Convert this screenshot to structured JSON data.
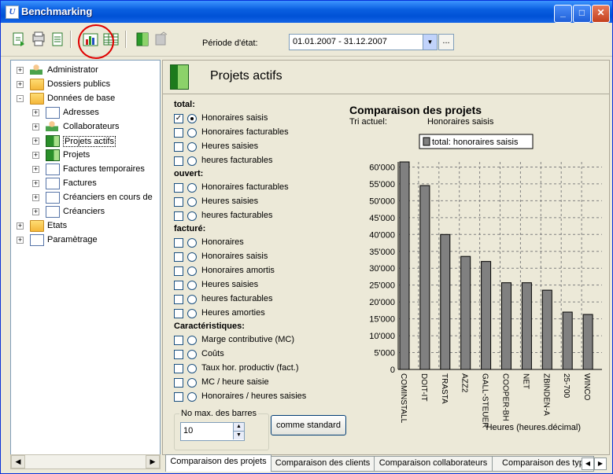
{
  "window": {
    "title": "Benchmarking",
    "app_icon_letter": "U"
  },
  "toolbar": {
    "period_label": "Période d'état:",
    "period_value": "01.01.2007 - 31.12.2007",
    "ellipsis_label": "..."
  },
  "tree": {
    "items": [
      {
        "label": "Administrator",
        "icon": "person-icon",
        "expander": "+"
      },
      {
        "label": "Dossiers publics",
        "icon": "folder-icon",
        "expander": "+"
      },
      {
        "label": "Données de base",
        "icon": "folder-icon",
        "expander": "−"
      },
      {
        "label": "Adresses",
        "icon": "address-book-icon",
        "expander": "+"
      },
      {
        "label": "Collaborateurs",
        "icon": "person-icon",
        "expander": "+"
      },
      {
        "label": "Projets actifs",
        "icon": "binder-icon",
        "expander": "+"
      },
      {
        "label": "Projets",
        "icon": "binder-icon",
        "expander": "+"
      },
      {
        "label": "Factures temporaires",
        "icon": "invoice-icon",
        "expander": "+"
      },
      {
        "label": "Factures",
        "icon": "invoice-icon",
        "expander": "+"
      },
      {
        "label": "Créanciers en cours de",
        "icon": "creditor-icon",
        "expander": "+"
      },
      {
        "label": "Créanciers",
        "icon": "creditor-icon",
        "expander": "+"
      },
      {
        "label": "Etats",
        "icon": "folder-icon",
        "expander": "+"
      },
      {
        "label": "Paramètrage",
        "icon": "settings-icon",
        "expander": "+"
      }
    ]
  },
  "main": {
    "title": "Projets actifs",
    "sections": [
      {
        "heading": "total:",
        "options": [
          {
            "label": "Honoraires saisis",
            "checked": true,
            "selected": true
          },
          {
            "label": "Honoraires facturables",
            "checked": false,
            "selected": false
          },
          {
            "label": "Heures saisies",
            "checked": false,
            "selected": false
          },
          {
            "label": "heures facturables",
            "checked": false,
            "selected": false
          }
        ]
      },
      {
        "heading": "ouvert:",
        "options": [
          {
            "label": "Honoraires facturables",
            "checked": false,
            "selected": false
          },
          {
            "label": "Heures saisies",
            "checked": false,
            "selected": false
          },
          {
            "label": "heures facturables",
            "checked": false,
            "selected": false
          }
        ]
      },
      {
        "heading": "facturé:",
        "options": [
          {
            "label": "Honoraires",
            "checked": false,
            "selected": false
          },
          {
            "label": "Honoraires saisis",
            "checked": false,
            "selected": false
          },
          {
            "label": "Honoraires amortis",
            "checked": false,
            "selected": false
          },
          {
            "label": "Heures saisies",
            "checked": false,
            "selected": false
          },
          {
            "label": "heures facturables",
            "checked": false,
            "selected": false
          },
          {
            "label": "Heures amorties",
            "checked": false,
            "selected": false
          }
        ]
      },
      {
        "heading": "Caractéristiques:",
        "options": [
          {
            "label": "Marge contributive (MC)",
            "checked": false,
            "selected": false
          },
          {
            "label": "Coûts",
            "checked": false,
            "selected": false
          },
          {
            "label": "Taux hor. productiv (fact.)",
            "checked": false,
            "selected": false
          },
          {
            "label": "MC / heure saisie",
            "checked": false,
            "selected": false
          },
          {
            "label": "Honoraires / heures saisies",
            "checked": false,
            "selected": false
          }
        ]
      }
    ],
    "max_bars_label": "No max. des barres",
    "max_bars_value": "10",
    "standard_button": "comme standard"
  },
  "chart_data": {
    "type": "bar",
    "title": "Comparaison des projets",
    "sort_label": "Tri actuel:",
    "sort_value": "Honoraires saisis",
    "legend": "total: honoraires saisis",
    "xlabel": "Heures (heures.décimal)",
    "categories": [
      "COMINSTALL",
      "DOIT-IT",
      "TRASTA",
      "AZZ2",
      "GALL-STEUER",
      "COOPER-BH",
      "NET",
      "ZBINDEN-A",
      "25-700",
      "WINCO"
    ],
    "values": [
      61500,
      54500,
      40000,
      33500,
      32000,
      25700,
      25700,
      23500,
      17000,
      16300
    ],
    "ylim": [
      0,
      61500
    ],
    "yticks": [
      0,
      5000,
      10000,
      15000,
      20000,
      25000,
      30000,
      35000,
      40000,
      45000,
      50000,
      55000,
      60000
    ],
    "ytick_labels": [
      "0",
      "5'000",
      "10'000",
      "15'000",
      "20'000",
      "25'000",
      "30'000",
      "35'000",
      "40'000",
      "45'000",
      "50'000",
      "55'000",
      "60'000"
    ],
    "grid": true,
    "colors": {
      "bar": "#808080"
    }
  },
  "tabs": [
    "Comparaison des projets",
    "Comparaison des clients",
    "Comparaison collaborateurs",
    "Comparaison des typ"
  ]
}
